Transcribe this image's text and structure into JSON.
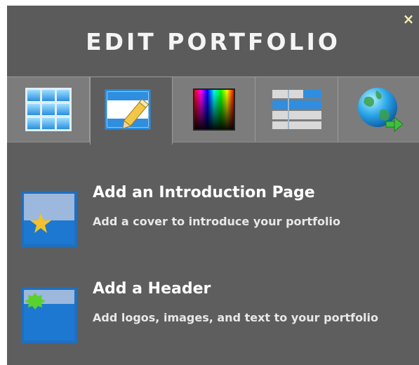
{
  "panel": {
    "title": "EDIT PORTFOLIO",
    "close_symbol": "×"
  },
  "tabs": [
    {
      "icon": "grid-layout-icon",
      "active": false
    },
    {
      "icon": "edit-page-icon",
      "active": true
    },
    {
      "icon": "color-palette-icon",
      "active": false
    },
    {
      "icon": "list-layout-icon",
      "active": false
    },
    {
      "icon": "globe-publish-icon",
      "active": false
    }
  ],
  "items": [
    {
      "title": "Add an Introduction Page",
      "description": "Add a cover to introduce your portfolio",
      "icon": "intro-page-icon"
    },
    {
      "title": "Add a Header",
      "description": "Add logos, images, and text to your portfolio",
      "icon": "header-icon"
    }
  ],
  "colors": {
    "panel_bg": "#5e5e5e",
    "tab_bar_bg": "#7c7c7c",
    "title_text": "#f4f4f4",
    "close_icon": "#f2eeb6",
    "thumb_blue": "#1f6fbf"
  }
}
